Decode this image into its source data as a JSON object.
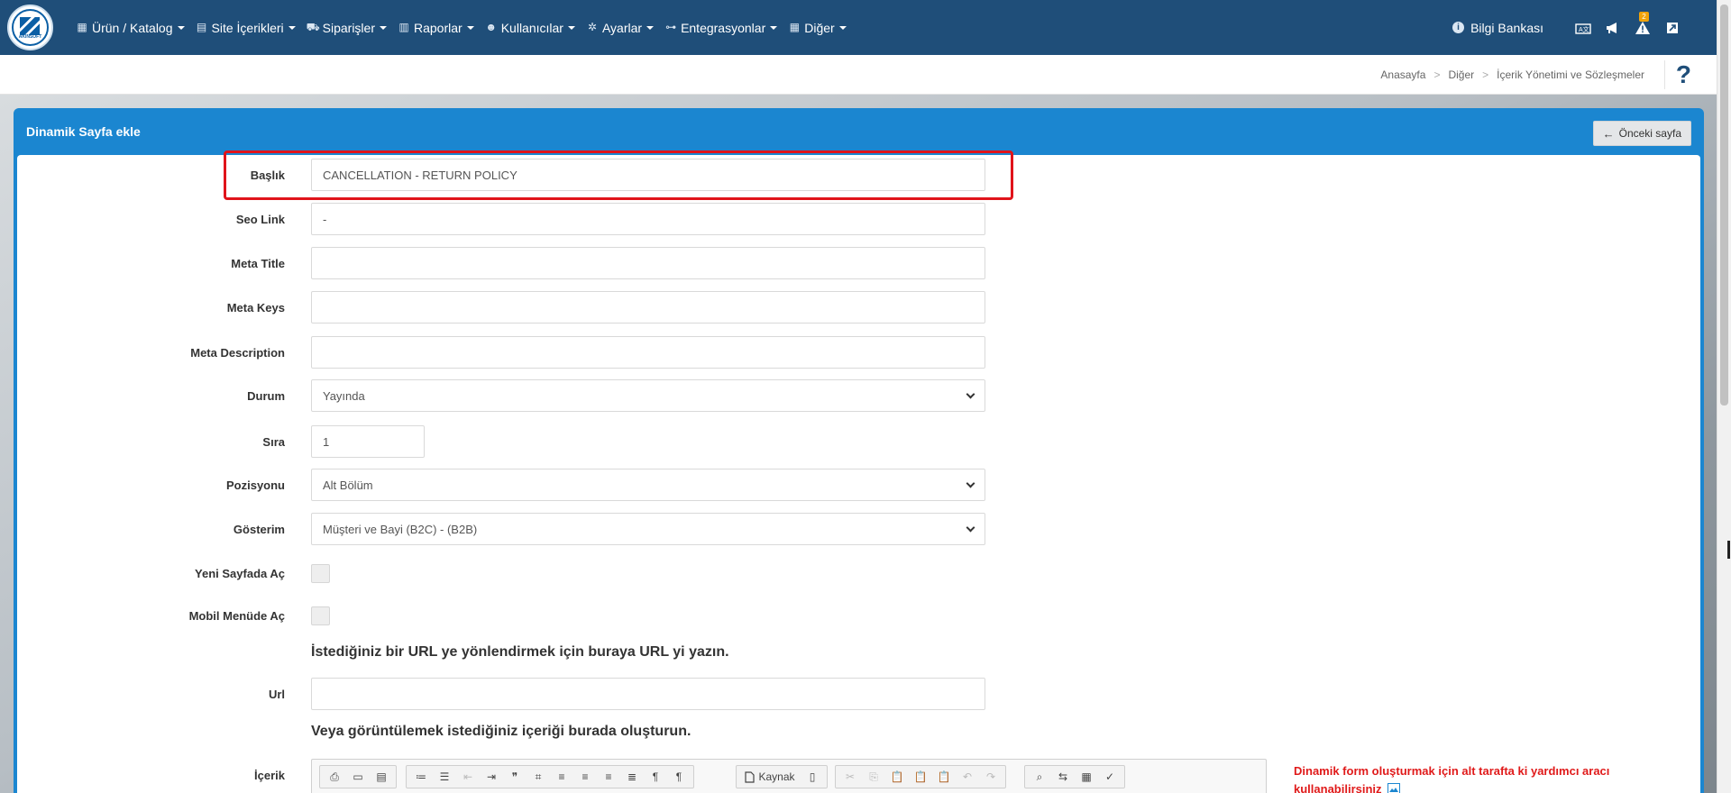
{
  "nav": {
    "items": [
      {
        "label": "Ürün / Katalog",
        "icon": "cubes-icon"
      },
      {
        "label": "Site İçerikleri",
        "icon": "document-icon"
      },
      {
        "label": "Siparişler",
        "icon": "truck-icon"
      },
      {
        "label": "Raporlar",
        "icon": "report-icon"
      },
      {
        "label": "Kullanıcılar",
        "icon": "users-icon"
      },
      {
        "label": "Ayarlar",
        "icon": "gears-icon"
      },
      {
        "label": "Entegrasyonlar",
        "icon": "sitemap-icon"
      },
      {
        "label": "Diğer",
        "icon": "grid-icon"
      }
    ],
    "bilgi_bankasi": "Bilgi Bankası",
    "alerts_badge": "2"
  },
  "breadcrumb": {
    "home": "Anasayfa",
    "level1": "Diğer",
    "level2": "İçerik Yönetimi ve Sözleşmeler",
    "separator": ">"
  },
  "panel": {
    "title": "Dinamik Sayfa ekle",
    "back_label": "Önceki sayfa"
  },
  "form": {
    "baslik": {
      "label": "Başlık",
      "value": "CANCELLATION - RETURN POLICY"
    },
    "seo_link": {
      "label": "Seo Link",
      "value": "-"
    },
    "meta_title": {
      "label": "Meta Title",
      "value": ""
    },
    "meta_keys": {
      "label": "Meta Keys",
      "value": ""
    },
    "meta_description": {
      "label": "Meta Description",
      "value": ""
    },
    "durum": {
      "label": "Durum",
      "value": "Yayında"
    },
    "sira": {
      "label": "Sıra",
      "value": "1"
    },
    "pozisyonu": {
      "label": "Pozisyonu",
      "value": "Alt Bölüm"
    },
    "gosterim": {
      "label": "Gösterim",
      "value": "Müşteri ve Bayi (B2C) - (B2B)"
    },
    "yeni_sayfada_ac": {
      "label": "Yeni Sayfada Aç",
      "checked": false
    },
    "mobil_menude_ac": {
      "label": "Mobil Menüde Aç",
      "checked": false
    },
    "url_note": "İstediğiniz bir URL ye yönlendirmek için buraya URL yi yazın.",
    "url": {
      "label": "Url",
      "value": ""
    },
    "content_note": "Veya görüntülemek istediğiniz içeriği burada oluşturun.",
    "icerik": {
      "label": "İçerik"
    },
    "source_button": "Kaynak"
  },
  "side_note": "Dinamik form oluşturmak için alt tarafta ki yardımcı aracı kullanabilirsiniz"
}
